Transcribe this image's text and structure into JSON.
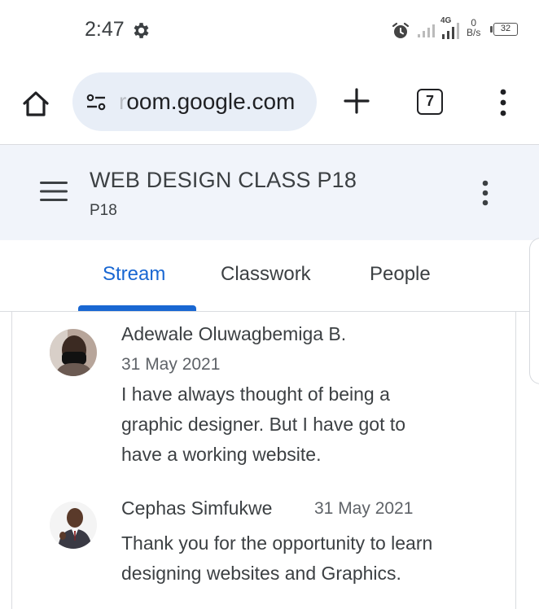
{
  "status_bar": {
    "time": "2:47",
    "network_type": "4G",
    "net_speed_value": "0",
    "net_speed_unit": "B/s",
    "battery": "32",
    "icons": [
      "gear-icon",
      "alarm-icon",
      "signal-icon",
      "battery-icon"
    ]
  },
  "browser": {
    "url_faded": "r",
    "url": "oom.google.com",
    "tab_count": "7",
    "icons": [
      "home-icon",
      "tune-icon",
      "plus-icon",
      "more-vert-icon"
    ]
  },
  "class_header": {
    "title": "WEB DESIGN CLASS P18",
    "subtitle": "P18",
    "icons": [
      "menu-icon",
      "more-vert-icon"
    ]
  },
  "tabs": [
    {
      "label": "Stream",
      "active": true
    },
    {
      "label": "Classwork",
      "active": false
    },
    {
      "label": "People",
      "active": false
    }
  ],
  "comments": [
    {
      "author": "Adewale Oluwagbemiga B.",
      "date": "31 May 2021",
      "text_lines": [
        "I have always thought of being a",
        "graphic designer. But I have got to",
        "have a working website."
      ]
    },
    {
      "author": "Cephas Simfukwe",
      "date": "31 May 2021",
      "text_lines": [
        "Thank you for the opportunity to learn",
        "designing websites and Graphics."
      ]
    }
  ],
  "colors": {
    "accent": "#1967d2",
    "header_bg": "#f1f4fa",
    "url_pill_bg": "#e8eef7",
    "text": "#3c4043"
  }
}
